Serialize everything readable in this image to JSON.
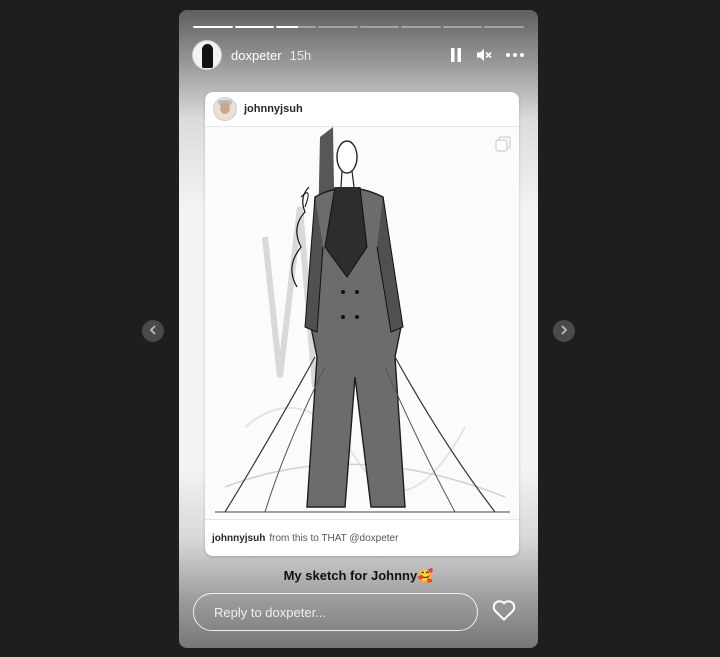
{
  "story": {
    "username": "doxpeter",
    "time_ago": "15h",
    "progress": {
      "segments": 8,
      "completed": 2,
      "current_fraction": 0.55
    },
    "controls": [
      "pause-icon",
      "mute-icon",
      "more-icon"
    ]
  },
  "shared_post": {
    "username": "johnnyjsuh",
    "caption_user": "johnnyjsuh",
    "caption_text": "from this to THAT @doxpeter",
    "image_icon": "multiple-images-icon"
  },
  "story_text": "My sketch for Johnny🥰",
  "reply": {
    "placeholder": "Reply to doxpeter..."
  },
  "colors": {
    "page_bg": "#1e1e1e",
    "nav_button_bg": "#4a4a4a"
  }
}
